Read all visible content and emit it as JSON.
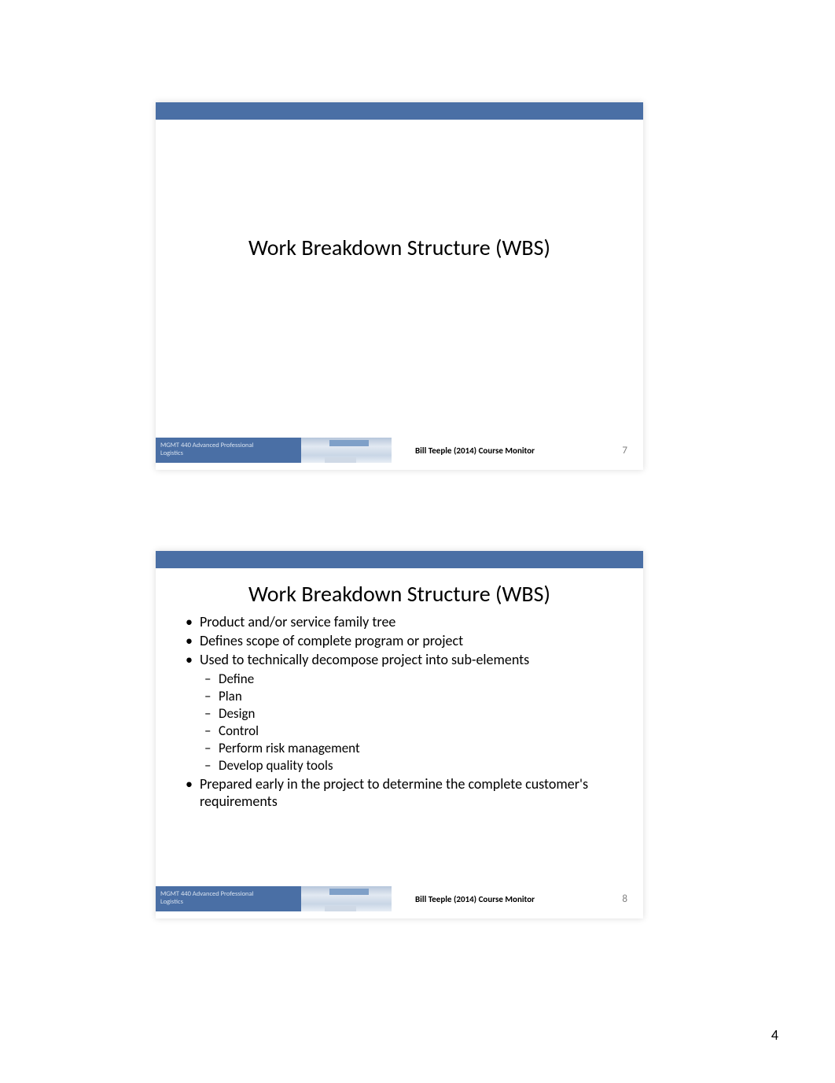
{
  "page_number": "4",
  "slide1": {
    "title": "Work Breakdown Structure (WBS)",
    "footer_course": "MGMT 440 Advanced Professional",
    "footer_course_line2": "Logistics",
    "footer_monitor": "Bill Teeple (2014) Course Monitor",
    "number": "7"
  },
  "slide2": {
    "title": "Work Breakdown Structure (WBS)",
    "bullets": [
      {
        "text": "Product and/or service family tree"
      },
      {
        "text": "Defines scope of complete program or project"
      },
      {
        "text": "Used to technically decompose project into sub-elements",
        "sub": [
          "Define",
          "Plan",
          "Design",
          "Control",
          "Perform risk management",
          "Develop quality tools"
        ]
      },
      {
        "text": "Prepared early in the project to determine the complete customer's requirements"
      }
    ],
    "footer_course": "MGMT 440 Advanced Professional",
    "footer_course_line2": "Logistics",
    "footer_monitor": "Bill Teeple (2014) Course Monitor",
    "number": "8"
  }
}
